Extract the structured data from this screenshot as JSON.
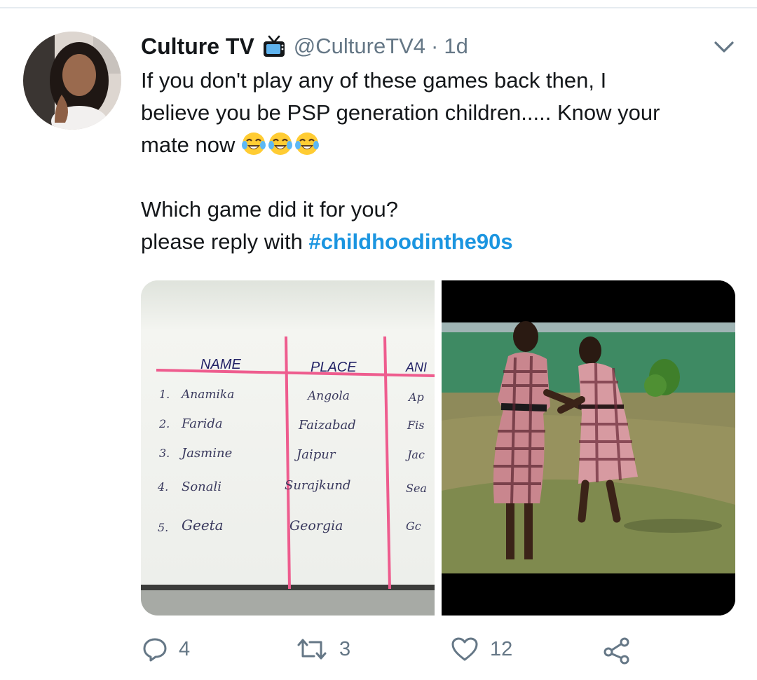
{
  "tweet": {
    "display_name": "Culture TV",
    "handle": "@CultureTV4",
    "separator": "·",
    "time": "1d",
    "text_line_1": "If you don't play any of these games back then, I",
    "text_line_2": "believe you be PSP generation children..... Know your",
    "text_line_3": "mate now",
    "text_line_4": "Which game did it for you?",
    "text_line_5_prefix": "please reply with ",
    "hashtag": "#childhoodinthe90s"
  },
  "media": {
    "left": {
      "headers": [
        "NAME",
        "PLACE",
        "ANI"
      ],
      "rows": [
        {
          "num": "1.",
          "name": "Anamika",
          "place": "Angola",
          "animal": "Ap"
        },
        {
          "num": "2.",
          "name": "Farida",
          "place": "Faizabad",
          "animal": "Fis"
        },
        {
          "num": "3.",
          "name": "Jasmine",
          "place": "Jaipur",
          "animal": "Jac"
        },
        {
          "num": "4.",
          "name": "Sonali",
          "place": "Surajkund",
          "animal": "Sea"
        },
        {
          "num": "5.",
          "name": "Geeta",
          "place": "Georgia",
          "animal": "Gc"
        }
      ]
    }
  },
  "actions": {
    "reply_count": "4",
    "retweet_count": "3",
    "like_count": "12"
  },
  "icons": {
    "verified_badge": "television-icon",
    "menu": "chevron-down-icon",
    "reply": "reply-icon",
    "retweet": "retweet-icon",
    "like": "heart-icon",
    "share": "share-icon"
  },
  "colors": {
    "link": "#1b95e0",
    "secondary": "#657786",
    "text": "#14171a"
  }
}
